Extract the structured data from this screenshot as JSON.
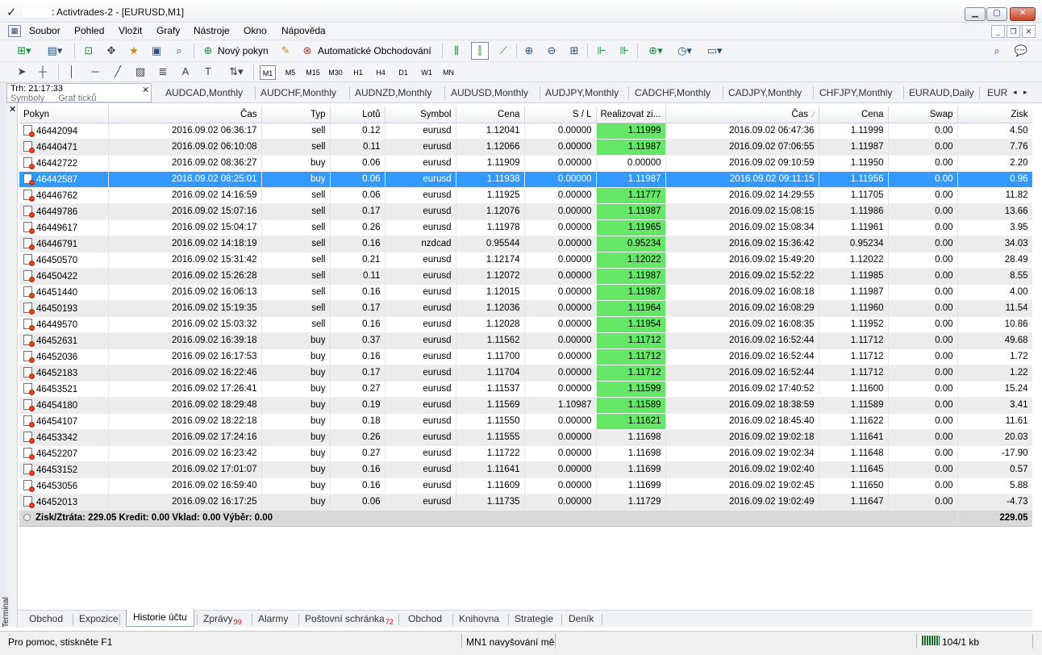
{
  "window": {
    "title": ": Activtrades-2 - [EURUSD,M1]",
    "min_icon": "minimize-icon",
    "max_icon": "maximize-icon",
    "close_icon": "close-icon"
  },
  "menu": {
    "items": [
      "Soubor",
      "Pohled",
      "Vložit",
      "Grafy",
      "Nástroje",
      "Okno",
      "Nápověda"
    ]
  },
  "toolbar": {
    "new_order_label": "Nový pokyn",
    "auto_trading_label": "Automatické Obchodování",
    "timeframes": [
      "M1",
      "M5",
      "M15",
      "M30",
      "H1",
      "H4",
      "D1",
      "W1",
      "MN"
    ],
    "active_timeframe": "M1"
  },
  "market_watch": {
    "time_label": "Trh: 21:17:33",
    "tabs": [
      "Symboly",
      "Graf ticků"
    ]
  },
  "chart_tabs": [
    "AUDCAD,Monthly",
    "AUDCHF,Monthly",
    "AUDNZD,Monthly",
    "AUDUSD,Monthly",
    "AUDJPY,Monthly",
    "CADCHF,Monthly",
    "CADJPY,Monthly",
    "CHFJPY,Monthly",
    "EURAUD,Daily",
    "EUR"
  ],
  "terminal": {
    "label": "Terminal",
    "columns": [
      "Pokyn",
      "Čas",
      "Typ",
      "Lotů",
      "Symbol",
      "Cena",
      "S / L",
      "Realizovat zi...",
      "Čas",
      "Cena",
      "Swap",
      "Zisk"
    ],
    "rows": [
      {
        "ticket": "46442094",
        "open_time": "2016.09.02 06:36:17",
        "type": "sell",
        "lots": "0.12",
        "symbol": "eurusd",
        "open_price": "1.12041",
        "sl": "0.00000",
        "tp": "1.11999",
        "tp_hit": true,
        "close_time": "2016.09.02 06:47:36",
        "close_price": "1.11999",
        "swap": "0.00",
        "profit": "4.50"
      },
      {
        "ticket": "46440471",
        "open_time": "2016.09.02 06:10:08",
        "type": "sell",
        "lots": "0.11",
        "symbol": "eurusd",
        "open_price": "1.12066",
        "sl": "0.00000",
        "tp": "1.11987",
        "tp_hit": true,
        "close_time": "2016.09.02 07:06:55",
        "close_price": "1.11987",
        "swap": "0.00",
        "profit": "7.76"
      },
      {
        "ticket": "46442722",
        "open_time": "2016.09.02 08:36:27",
        "type": "buy",
        "lots": "0.06",
        "symbol": "eurusd",
        "open_price": "1.11909",
        "sl": "0.00000",
        "tp": "0.00000",
        "tp_hit": false,
        "close_time": "2016.09.02 09:10:59",
        "close_price": "1.11950",
        "swap": "0.00",
        "profit": "2.20"
      },
      {
        "ticket": "46442587",
        "open_time": "2016.09.02 08:25:01",
        "type": "buy",
        "lots": "0.06",
        "symbol": "eurusd",
        "open_price": "1.11938",
        "sl": "0.00000",
        "tp": "1.11987",
        "tp_hit": true,
        "close_time": "2016.09.02 09:11:15",
        "close_price": "1.11956",
        "swap": "0.00",
        "profit": "0.96",
        "selected": true
      },
      {
        "ticket": "46446762",
        "open_time": "2016.09.02 14:16:59",
        "type": "sell",
        "lots": "0.06",
        "symbol": "eurusd",
        "open_price": "1.11925",
        "sl": "0.00000",
        "tp": "1.11777",
        "tp_hit": true,
        "close_time": "2016.09.02 14:29:55",
        "close_price": "1.11705",
        "swap": "0.00",
        "profit": "11.82"
      },
      {
        "ticket": "46449786",
        "open_time": "2016.09.02 15:07:16",
        "type": "sell",
        "lots": "0.17",
        "symbol": "eurusd",
        "open_price": "1.12076",
        "sl": "0.00000",
        "tp": "1.11987",
        "tp_hit": true,
        "close_time": "2016.09.02 15:08:15",
        "close_price": "1.11986",
        "swap": "0.00",
        "profit": "13.66"
      },
      {
        "ticket": "46449617",
        "open_time": "2016.09.02 15:04:17",
        "type": "sell",
        "lots": "0.26",
        "symbol": "eurusd",
        "open_price": "1.11978",
        "sl": "0.00000",
        "tp": "1.11965",
        "tp_hit": true,
        "close_time": "2016.09.02 15:08:34",
        "close_price": "1.11961",
        "swap": "0.00",
        "profit": "3.95"
      },
      {
        "ticket": "46446791",
        "open_time": "2016.09.02 14:18:19",
        "type": "sell",
        "lots": "0.16",
        "symbol": "nzdcad",
        "open_price": "0.95544",
        "sl": "0.00000",
        "tp": "0.95234",
        "tp_hit": true,
        "close_time": "2016.09.02 15:36:42",
        "close_price": "0.95234",
        "swap": "0.00",
        "profit": "34.03"
      },
      {
        "ticket": "46450570",
        "open_time": "2016.09.02 15:31:42",
        "type": "sell",
        "lots": "0.21",
        "symbol": "eurusd",
        "open_price": "1.12174",
        "sl": "0.00000",
        "tp": "1.12022",
        "tp_hit": true,
        "close_time": "2016.09.02 15:49:20",
        "close_price": "1.12022",
        "swap": "0.00",
        "profit": "28.49"
      },
      {
        "ticket": "46450422",
        "open_time": "2016.09.02 15:26:28",
        "type": "sell",
        "lots": "0.11",
        "symbol": "eurusd",
        "open_price": "1.12072",
        "sl": "0.00000",
        "tp": "1.11987",
        "tp_hit": true,
        "close_time": "2016.09.02 15:52:22",
        "close_price": "1.11985",
        "swap": "0.00",
        "profit": "8.55"
      },
      {
        "ticket": "46451440",
        "open_time": "2016.09.02 16:06:13",
        "type": "sell",
        "lots": "0.16",
        "symbol": "eurusd",
        "open_price": "1.12015",
        "sl": "0.00000",
        "tp": "1.11987",
        "tp_hit": true,
        "close_time": "2016.09.02 16:08:18",
        "close_price": "1.11987",
        "swap": "0.00",
        "profit": "4.00"
      },
      {
        "ticket": "46450193",
        "open_time": "2016.09.02 15:19:35",
        "type": "sell",
        "lots": "0.17",
        "symbol": "eurusd",
        "open_price": "1.12036",
        "sl": "0.00000",
        "tp": "1.11964",
        "tp_hit": true,
        "close_time": "2016.09.02 16:08:29",
        "close_price": "1.11960",
        "swap": "0.00",
        "profit": "11.54"
      },
      {
        "ticket": "46449570",
        "open_time": "2016.09.02 15:03:32",
        "type": "sell",
        "lots": "0.16",
        "symbol": "eurusd",
        "open_price": "1.12028",
        "sl": "0.00000",
        "tp": "1.11954",
        "tp_hit": true,
        "close_time": "2016.09.02 16:08:35",
        "close_price": "1.11952",
        "swap": "0.00",
        "profit": "10.86"
      },
      {
        "ticket": "46452631",
        "open_time": "2016.09.02 16:39:18",
        "type": "buy",
        "lots": "0.37",
        "symbol": "eurusd",
        "open_price": "1.11562",
        "sl": "0.00000",
        "tp": "1.11712",
        "tp_hit": true,
        "close_time": "2016.09.02 16:52:44",
        "close_price": "1.11712",
        "swap": "0.00",
        "profit": "49.68"
      },
      {
        "ticket": "46452036",
        "open_time": "2016.09.02 16:17:53",
        "type": "buy",
        "lots": "0.16",
        "symbol": "eurusd",
        "open_price": "1.11700",
        "sl": "0.00000",
        "tp": "1.11712",
        "tp_hit": true,
        "close_time": "2016.09.02 16:52:44",
        "close_price": "1.11712",
        "swap": "0.00",
        "profit": "1.72"
      },
      {
        "ticket": "46452183",
        "open_time": "2016.09.02 16:22:46",
        "type": "buy",
        "lots": "0.17",
        "symbol": "eurusd",
        "open_price": "1.11704",
        "sl": "0.00000",
        "tp": "1.11712",
        "tp_hit": true,
        "close_time": "2016.09.02 16:52:44",
        "close_price": "1.11712",
        "swap": "0.00",
        "profit": "1.22"
      },
      {
        "ticket": "46453521",
        "open_time": "2016.09.02 17:26:41",
        "type": "buy",
        "lots": "0.27",
        "symbol": "eurusd",
        "open_price": "1.11537",
        "sl": "0.00000",
        "tp": "1.11599",
        "tp_hit": true,
        "close_time": "2016.09.02 17:40:52",
        "close_price": "1.11600",
        "swap": "0.00",
        "profit": "15.24"
      },
      {
        "ticket": "46454180",
        "open_time": "2016.09.02 18:29:48",
        "type": "buy",
        "lots": "0.19",
        "symbol": "eurusd",
        "open_price": "1.11569",
        "sl": "1.10987",
        "tp": "1.11589",
        "tp_hit": true,
        "close_time": "2016.09.02 18:38:59",
        "close_price": "1.11589",
        "swap": "0.00",
        "profit": "3.41"
      },
      {
        "ticket": "46454107",
        "open_time": "2016.09.02 18:22:18",
        "type": "buy",
        "lots": "0.18",
        "symbol": "eurusd",
        "open_price": "1.11550",
        "sl": "0.00000",
        "tp": "1.11621",
        "tp_hit": true,
        "close_time": "2016.09.02 18:45:40",
        "close_price": "1.11622",
        "swap": "0.00",
        "profit": "11.61"
      },
      {
        "ticket": "46453342",
        "open_time": "2016.09.02 17:24:16",
        "type": "buy",
        "lots": "0.26",
        "symbol": "eurusd",
        "open_price": "1.11555",
        "sl": "0.00000",
        "tp": "1.11698",
        "tp_hit": false,
        "close_time": "2016.09.02 19:02:18",
        "close_price": "1.11641",
        "swap": "0.00",
        "profit": "20.03"
      },
      {
        "ticket": "46452207",
        "open_time": "2016.09.02 16:23:42",
        "type": "buy",
        "lots": "0.27",
        "symbol": "eurusd",
        "open_price": "1.11722",
        "sl": "0.00000",
        "tp": "1.11698",
        "tp_hit": false,
        "close_time": "2016.09.02 19:02:34",
        "close_price": "1.11648",
        "swap": "0.00",
        "profit": "-17.90"
      },
      {
        "ticket": "46453152",
        "open_time": "2016.09.02 17:01:07",
        "type": "buy",
        "lots": "0.16",
        "symbol": "eurusd",
        "open_price": "1.11641",
        "sl": "0.00000",
        "tp": "1.11699",
        "tp_hit": false,
        "close_time": "2016.09.02 19:02:40",
        "close_price": "1.11645",
        "swap": "0.00",
        "profit": "0.57"
      },
      {
        "ticket": "46453056",
        "open_time": "2016.09.02 16:59:40",
        "type": "buy",
        "lots": "0.16",
        "symbol": "eurusd",
        "open_price": "1.11609",
        "sl": "0.00000",
        "tp": "1.11699",
        "tp_hit": false,
        "close_time": "2016.09.02 19:02:45",
        "close_price": "1.11650",
        "swap": "0.00",
        "profit": "5.88"
      },
      {
        "ticket": "46452013",
        "open_time": "2016.09.02 16:17:25",
        "type": "buy",
        "lots": "0.06",
        "symbol": "eurusd",
        "open_price": "1.11735",
        "sl": "0.00000",
        "tp": "1.11729",
        "tp_hit": false,
        "close_time": "2016.09.02 19:02:49",
        "close_price": "1.11647",
        "swap": "0.00",
        "profit": "-4.73"
      }
    ],
    "summary": {
      "text": "Zisk/Ztráta: 229.05  Kredit: 0.00  Vklad: 0.00  Výběr: 0.00",
      "total": "229.05"
    },
    "tabs": [
      {
        "label": "Obchod"
      },
      {
        "label": "Expozice"
      },
      {
        "label": "Historie účtu",
        "active": true
      },
      {
        "label": "Zprávy",
        "badge": "99"
      },
      {
        "label": "Alarmy"
      },
      {
        "label": "Poštovní schránka",
        "badge": "72"
      },
      {
        "label": "Obchod"
      },
      {
        "label": "Knihovna"
      },
      {
        "label": "Strategie"
      },
      {
        "label": "Deník"
      }
    ]
  },
  "status": {
    "help": "Pro pomoc, stiskněte F1",
    "profile": "MN1 navyšování mě",
    "traffic": "104/1 kb"
  },
  "colors": {
    "highlight_green": "#66e666",
    "selected_row": "#3399ff",
    "row_alt": "#ececec"
  }
}
